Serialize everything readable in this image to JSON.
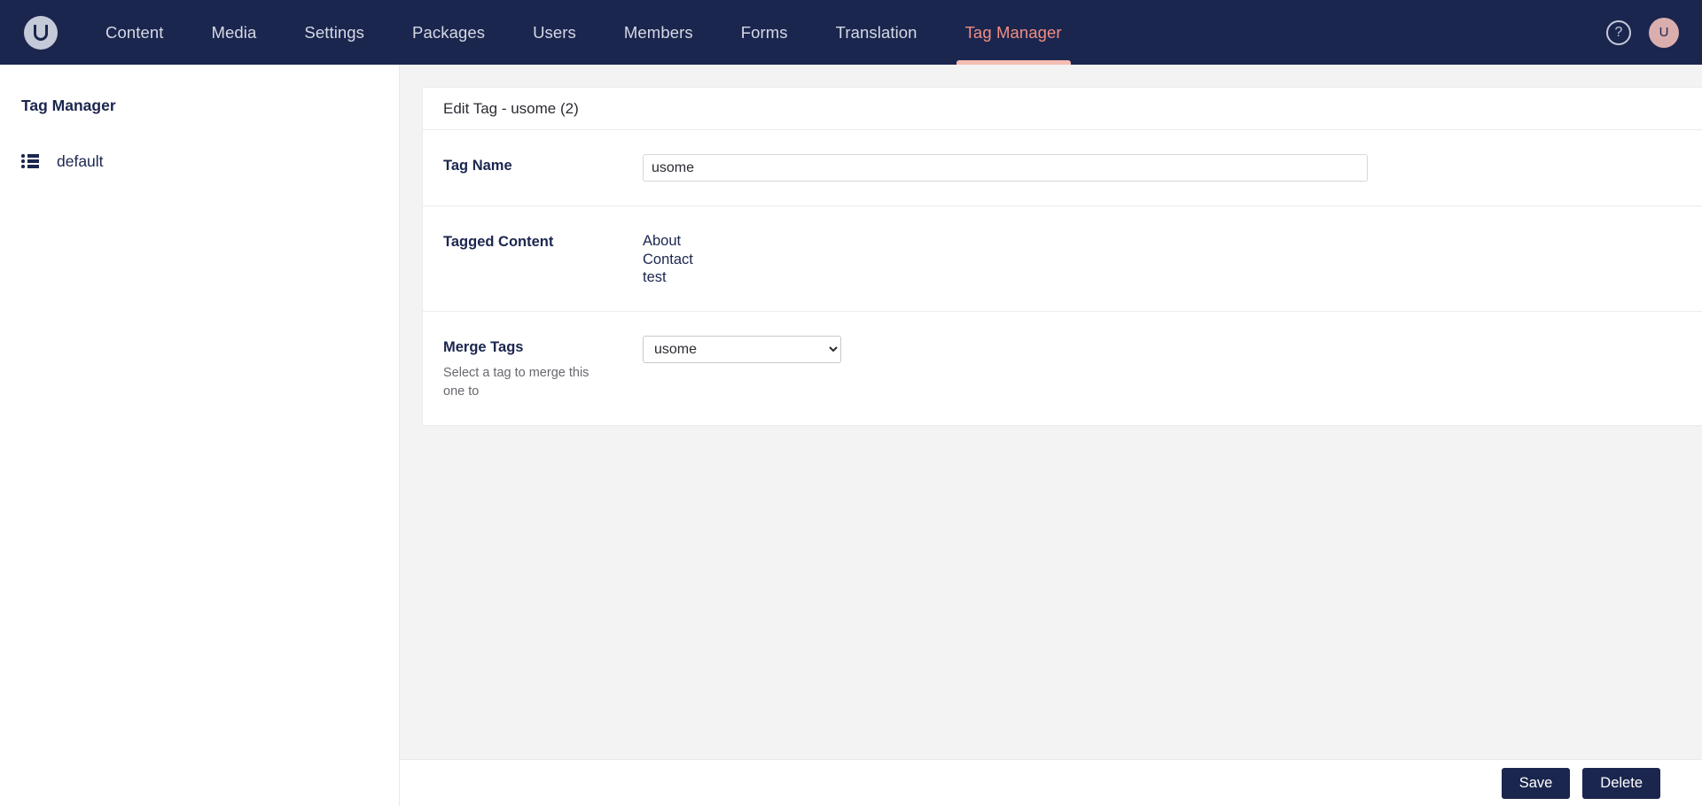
{
  "topnav": {
    "logo_alt": "Umbraco",
    "items": [
      {
        "label": "Content",
        "active": false
      },
      {
        "label": "Media",
        "active": false
      },
      {
        "label": "Settings",
        "active": false
      },
      {
        "label": "Packages",
        "active": false
      },
      {
        "label": "Users",
        "active": false
      },
      {
        "label": "Members",
        "active": false
      },
      {
        "label": "Forms",
        "active": false
      },
      {
        "label": "Translation",
        "active": false
      },
      {
        "label": "Tag Manager",
        "active": true
      }
    ],
    "help_label": "?",
    "avatar_initial": "U",
    "bg_color": "#1b264f",
    "active_color": "#f08e80",
    "active_underline_color": "#f5bcb3",
    "avatar_bg": "#dbaeae"
  },
  "sidebar": {
    "title": "Tag Manager",
    "items": [
      {
        "label": "default",
        "icon": "list-icon"
      }
    ]
  },
  "editor": {
    "header": "Edit Tag - usome (2)",
    "tag_name": {
      "label": "Tag Name",
      "value": "usome",
      "placeholder": ""
    },
    "tagged_content": {
      "label": "Tagged Content",
      "items": [
        "About",
        "Contact",
        "test"
      ]
    },
    "merge_tags": {
      "label": "Merge Tags",
      "description": "Select a tag to merge this one to",
      "selected": "usome",
      "options": [
        "usome"
      ]
    }
  },
  "footer": {
    "save_label": "Save",
    "delete_label": "Delete",
    "button_color": "#1b264f"
  }
}
